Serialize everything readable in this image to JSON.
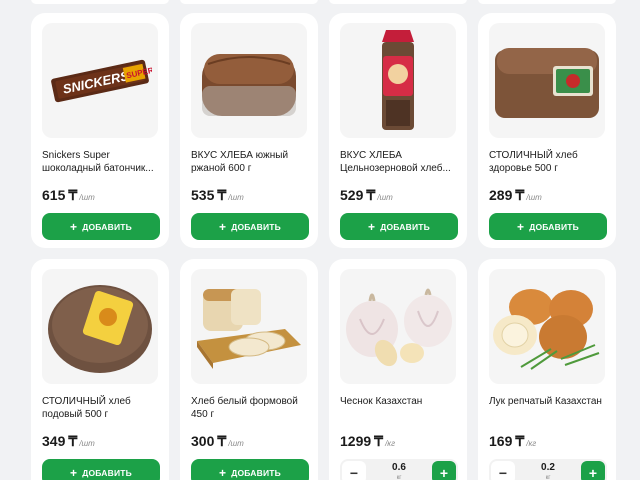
{
  "currency_symbol": "₸",
  "products": [
    {
      "name": "Snickers Super шоколадный батончик...",
      "price": "615",
      "unit": "/шт",
      "action": "ДОБАВИТЬ",
      "image_icon": "snickers-bar-icon"
    },
    {
      "name": "ВКУС ХЛЕБА южный ржаной 600 г",
      "price": "535",
      "unit": "/шт",
      "action": "ДОБАВИТЬ",
      "image_icon": "rye-bread-loaf-icon"
    },
    {
      "name": "ВКУС ХЛЕБА Цельнозерновой хлеб...",
      "price": "529",
      "unit": "/шт",
      "action": "ДОБАВИТЬ",
      "image_icon": "wholegrain-bread-bag-icon"
    },
    {
      "name": "СТОЛИЧНЫЙ хлеб здоровье 500 г",
      "price": "289",
      "unit": "/шт",
      "action": "ДОБАВИТЬ",
      "image_icon": "bread-loaf-icon"
    },
    {
      "name": "СТОЛИЧНЫЙ хлеб подовый 500 г",
      "price": "349",
      "unit": "/шт",
      "action": "ДОБАВИТЬ",
      "image_icon": "round-bread-icon"
    },
    {
      "name": "Хлеб белый формовой 450 г",
      "price": "300",
      "unit": "/шт",
      "action": "ДОБАВИТЬ",
      "image_icon": "white-bread-icon"
    },
    {
      "name": "Чеснок Казахстан",
      "price": "1299",
      "unit": "/кг",
      "quantity": "0.6",
      "quantity_unit": "кг",
      "image_icon": "garlic-icon"
    },
    {
      "name": "Лук репчатый Казахстан",
      "price": "169",
      "unit": "/кг",
      "quantity": "0.2",
      "quantity_unit": "кг",
      "image_icon": "onion-icon"
    }
  ]
}
